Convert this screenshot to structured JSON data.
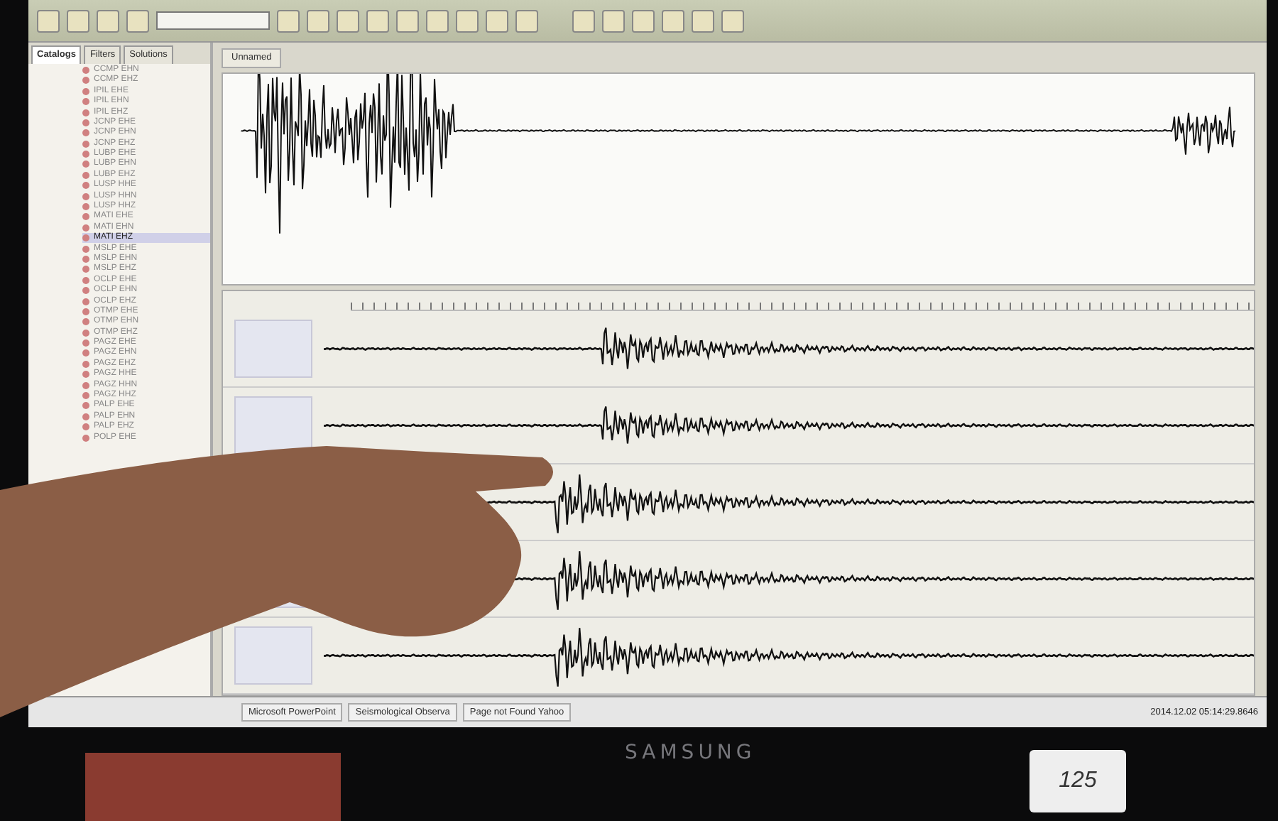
{
  "left_panel": {
    "tabs": [
      {
        "label": "Catalogs",
        "selected": true
      },
      {
        "label": "Filters",
        "selected": false
      },
      {
        "label": "Solutions",
        "selected": false
      }
    ],
    "stations": [
      {
        "label": "CCMP EHN",
        "selected": false
      },
      {
        "label": "CCMP EHZ",
        "selected": false
      },
      {
        "label": "IPIL EHE",
        "selected": false
      },
      {
        "label": "IPIL EHN",
        "selected": false
      },
      {
        "label": "IPIL EHZ",
        "selected": false
      },
      {
        "label": "JCNP EHE",
        "selected": false
      },
      {
        "label": "JCNP EHN",
        "selected": false
      },
      {
        "label": "JCNP EHZ",
        "selected": false
      },
      {
        "label": "LUBP EHE",
        "selected": false
      },
      {
        "label": "LUBP EHN",
        "selected": false
      },
      {
        "label": "LUBP EHZ",
        "selected": false
      },
      {
        "label": "LUSP HHE",
        "selected": false
      },
      {
        "label": "LUSP HHN",
        "selected": false
      },
      {
        "label": "LUSP HHZ",
        "selected": false
      },
      {
        "label": "MATI EHE",
        "selected": false
      },
      {
        "label": "MATI EHN",
        "selected": false
      },
      {
        "label": "MATI EHZ",
        "selected": true
      },
      {
        "label": "MSLP EHE",
        "selected": false
      },
      {
        "label": "MSLP EHN",
        "selected": false
      },
      {
        "label": "MSLP EHZ",
        "selected": false
      },
      {
        "label": "OCLP EHE",
        "selected": false
      },
      {
        "label": "OCLP EHN",
        "selected": false
      },
      {
        "label": "OCLP EHZ",
        "selected": false
      },
      {
        "label": "OTMP EHE",
        "selected": false
      },
      {
        "label": "OTMP EHN",
        "selected": false
      },
      {
        "label": "OTMP EHZ",
        "selected": false
      },
      {
        "label": "PAGZ EHE",
        "selected": false
      },
      {
        "label": "PAGZ EHN",
        "selected": false
      },
      {
        "label": "PAGZ EHZ",
        "selected": false
      },
      {
        "label": "PAGZ HHE",
        "selected": false
      },
      {
        "label": "PAGZ HHN",
        "selected": false
      },
      {
        "label": "PAGZ HHZ",
        "selected": false
      },
      {
        "label": "PALP EHE",
        "selected": false
      },
      {
        "label": "PALP EHN",
        "selected": false
      },
      {
        "label": "PALP EHZ",
        "selected": false
      },
      {
        "label": "POLP EHE",
        "selected": false
      }
    ]
  },
  "document_tab": {
    "label": "Unnamed"
  },
  "taskbar": {
    "items": [
      {
        "label": "Microsoft PowerPoint"
      },
      {
        "label": "Seismological Observa"
      },
      {
        "label": "Page not Found Yahoo"
      }
    ],
    "clock": "2014.12.02 05:14:29.8646"
  },
  "bezel": {
    "brand": "SAMSUNG"
  },
  "sticker": {
    "text": "125"
  }
}
